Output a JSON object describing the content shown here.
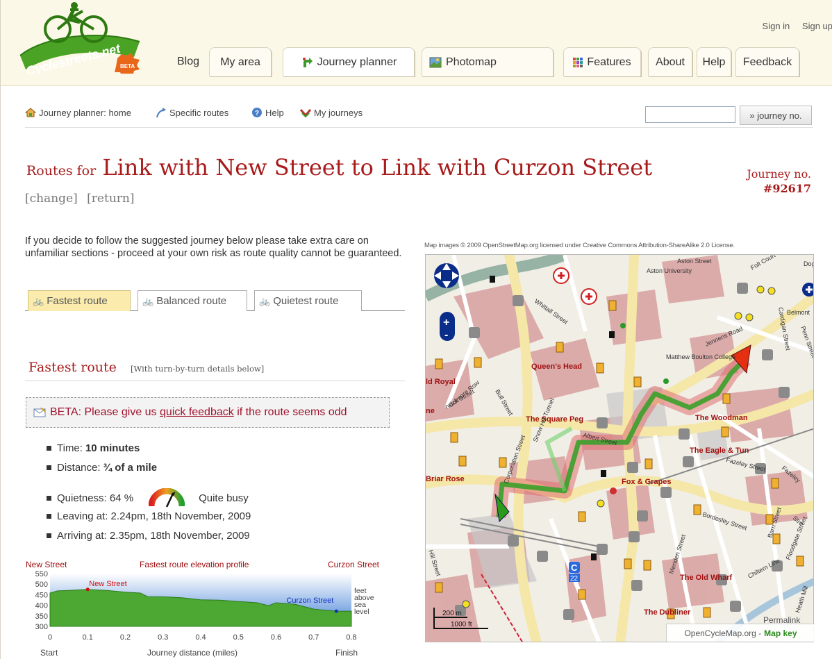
{
  "account": {
    "sign_in": "Sign in",
    "sign_up": "Sign up"
  },
  "logo": {
    "text": "Cyclestreets.net",
    "badge": "BETA"
  },
  "nav": {
    "blog": "Blog",
    "my_area": "My area",
    "journey_planner": "Journey planner",
    "photomap": "Photomap",
    "features": "Features",
    "about": "About",
    "help": "Help",
    "feedback": "Feedback"
  },
  "subnav": {
    "home": "Journey planner: home",
    "specific": "Specific routes",
    "help": "Help",
    "my_journeys": "My journeys",
    "journey_no_button": "» journey no."
  },
  "title": {
    "prefix": "Routes for",
    "main": "Link with New Street to Link with Curzon Street",
    "change": "[change]",
    "return": "[return]",
    "journey_no_label": "Journey no.",
    "journey_no_value": "#92617"
  },
  "warning": "If you decide to follow the suggested journey below please take extra care on unfamiliar sections - proceed at your own risk as route quality cannot be guaranteed.",
  "route_tabs": {
    "fastest": "Fastest route",
    "balanced": "Balanced route",
    "quietest": "Quietest route"
  },
  "section": {
    "title": "Fastest route",
    "note": "[With turn-by-turn details below]"
  },
  "beta": {
    "prefix": "BETA: Please give us ",
    "link": "quick feedback",
    "suffix": " if the route seems odd"
  },
  "facts": {
    "time_label": "Time:",
    "time_value": "10 minutes",
    "distance_label": "Distance:",
    "distance_value": "¾ of a mile",
    "quietness_label": "Quietness: 64 %",
    "quietness_value": "Quite busy",
    "quietness_pct": 64,
    "leaving": "Leaving at: 2.24pm, 18th November, 2009",
    "arriving": "Arriving at: 2.35pm, 18th November, 2009"
  },
  "chart_data": {
    "type": "area",
    "title": "Fastest route elevation profile",
    "start_label": "New Street",
    "end_label": "Curzon Street",
    "xlabel": "Journey distance (miles)",
    "x_start": "Start",
    "x_finish": "Finish",
    "ylabel_lines": [
      "feet",
      "above",
      "sea",
      "level"
    ],
    "xlim": [
      0,
      0.8
    ],
    "ylim": [
      300,
      550
    ],
    "x_ticks": [
      "0",
      "0.1",
      "0.2",
      "0.3",
      "0.4",
      "0.5",
      "0.6",
      "0.7",
      "0.8"
    ],
    "y_ticks": [
      "550",
      "500",
      "450",
      "400",
      "350",
      "300"
    ],
    "x": [
      0,
      0.02,
      0.05,
      0.1,
      0.15,
      0.2,
      0.24,
      0.26,
      0.3,
      0.35,
      0.4,
      0.45,
      0.5,
      0.55,
      0.58,
      0.6,
      0.65,
      0.7,
      0.72,
      0.76,
      0.8
    ],
    "y": [
      458,
      468,
      470,
      475,
      470,
      462,
      458,
      440,
      440,
      436,
      426,
      424,
      418,
      412,
      398,
      412,
      405,
      382,
      378,
      372,
      372
    ],
    "markers": [
      {
        "label": "New Street",
        "x": 0.1,
        "y": 475,
        "color": "#d01010"
      },
      {
        "label": "Curzon Street",
        "x": 0.76,
        "y": 372,
        "color": "#1030c0"
      }
    ]
  },
  "map": {
    "attribution": "Map images © 2009 OpenStreetMap.org licensed under Creative Commons Attribution-ShareAlike 2.0 License.",
    "permalink": "Permalink",
    "credit": "OpenCycleMap.org -",
    "map_key": "Map key",
    "scale_m": "200 m",
    "scale_ft": "1000 ft",
    "labels": {
      "queens_head": "Queen's Head",
      "square_peg": "The Square Peg",
      "woodman": "The Woodman",
      "eagle": "The Eagle & Tun",
      "fox": "Fox & Grapes",
      "briar": "Briar Rose",
      "old_wharf": "The Old Wharf",
      "dubliner": "The Dubliner",
      "ld_royal": "ld Royal",
      "ne": "ne",
      "aston_uni": "Aston University",
      "aston_st": "Aston Street",
      "matthew": "Matthew Boulton College",
      "jennens": "Jennens Road",
      "whittall": "Whittall Street",
      "bull": "Bull Street",
      "colmore": "Colmore Row",
      "corporation": "Corporation Street",
      "snowhill": "Snow Hill Tunnel",
      "albert": "Albert Street",
      "fazeley": "Fazeley Street",
      "fazeley2": "Fazeley",
      "bordesley": "Bordesley Street",
      "meriden": "Meriden Street",
      "chiltern": "Chiltern Line",
      "cardigan": "Cardigan Street",
      "belmont": "Belmont",
      "penn": "Penn Street",
      "hill": "Hill Street",
      "barn": "Barn Street",
      "floodgate": "Floodgate Street",
      "heath": "Heath Mill",
      "folt": "Folt Court",
      "dog": "Dog",
      "warwick": "rwick Street",
      "str": "Stre",
      "c22": "22",
      "bus_c": "C"
    }
  }
}
